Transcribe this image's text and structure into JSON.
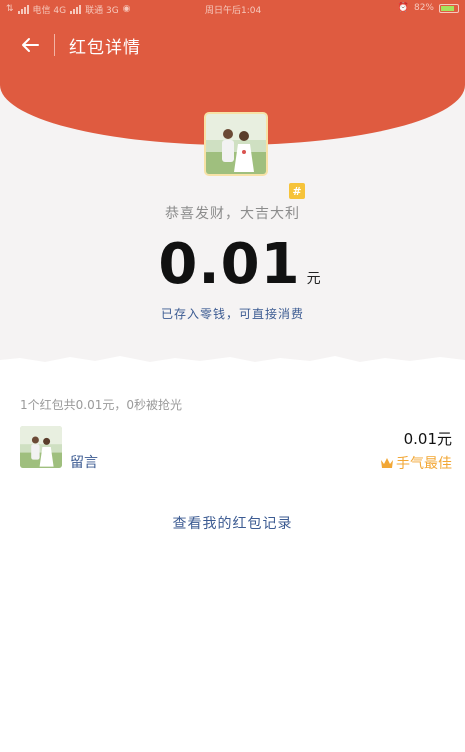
{
  "status_bar": {
    "carrier1": "电信 4G",
    "carrier2": "联通 3G",
    "time": "周日午后1:04",
    "battery": "82%",
    "battery_level": 0.82
  },
  "nav": {
    "title": "红包详情"
  },
  "packet": {
    "hash_badge": "#",
    "blessing": "恭喜发财，大吉大利",
    "amount": "0.01",
    "unit": "元",
    "deposit_note": "已存入零钱，可直接消费"
  },
  "summary": "1个红包共0.01元，0秒被抢光",
  "recipient": {
    "name": "留言",
    "amount": "0.01元",
    "badge": "手气最佳"
  },
  "footer": {
    "record_link": "查看我的红包记录"
  },
  "colors": {
    "header": "#df5b40",
    "link": "#3c5b92",
    "best_luck": "#f2a735"
  },
  "icons": {
    "back": "arrow-left-icon",
    "crown": "crown-icon",
    "alarm": "alarm-icon"
  }
}
